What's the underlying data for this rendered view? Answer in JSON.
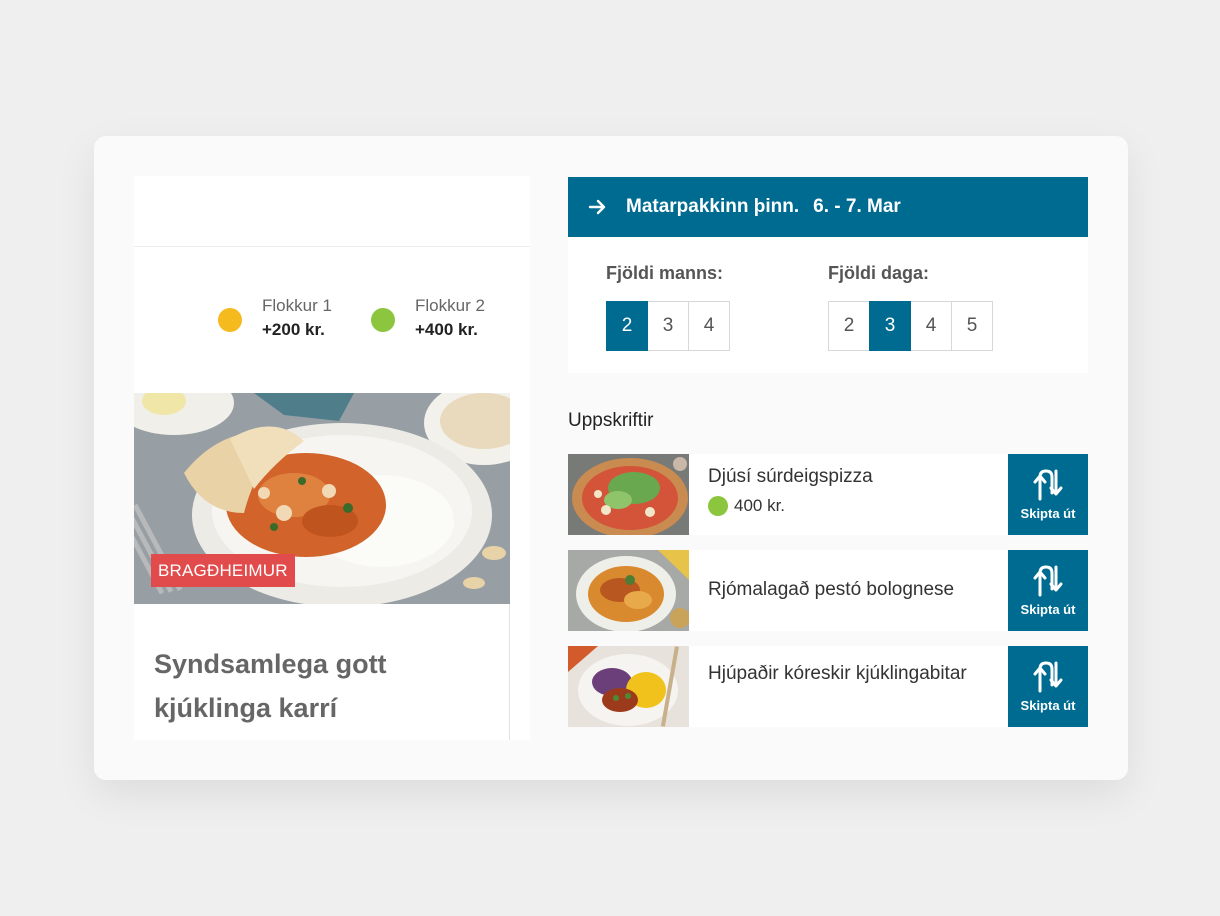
{
  "left_card": {
    "categories": [
      {
        "name": "Flokkur 1",
        "price": "+200 kr.",
        "color": "#f5bb1e"
      },
      {
        "name": "Flokkur 2",
        "price": "+400 kr.",
        "color": "#8cc63f"
      }
    ],
    "brand_badge": "BRAGÐHEIMUR",
    "recipe_title": "Syndsamlega gott kjúklinga karrí"
  },
  "header": {
    "title": "Matarpakkinn þinn.",
    "date": "6. - 7. Mar",
    "icon": "arrow-right-icon"
  },
  "selectors": {
    "people": {
      "label": "Fjöldi manns:",
      "options": [
        "2",
        "3",
        "4"
      ],
      "selected": "2"
    },
    "days": {
      "label": "Fjöldi daga:",
      "options": [
        "2",
        "3",
        "4",
        "5"
      ],
      "selected": "3"
    }
  },
  "recipes": {
    "heading": "Uppskriftir",
    "items": [
      {
        "name": "Djúsí súrdeigspizza",
        "price": "400 kr.",
        "price_color": "#8cc63f",
        "swap_label": "Skipta út"
      },
      {
        "name": "Rjómalagað pestó bolognese",
        "swap_label": "Skipta út"
      },
      {
        "name": "Hjúpaðir kóreskir kjúklingabitar",
        "swap_label": "Skipta út"
      }
    ]
  },
  "colors": {
    "accent": "#006b91",
    "badge": "#e14b4b"
  }
}
